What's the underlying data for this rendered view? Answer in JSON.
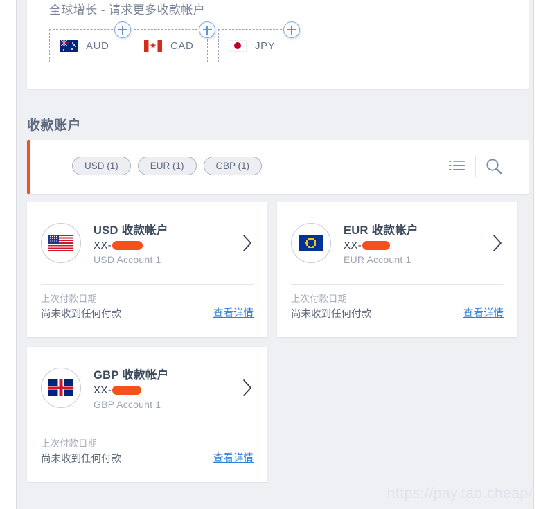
{
  "global_growth": {
    "title": "全球增长 - 请求更多收款帐户",
    "currencies": [
      {
        "code": "AUD",
        "flag": "australia-flag-icon",
        "add_icon": "plus-circle-icon"
      },
      {
        "code": "CAD",
        "flag": "canada-flag-icon",
        "add_icon": "plus-circle-icon"
      },
      {
        "code": "JPY",
        "flag": "japan-flag-icon",
        "add_icon": "plus-circle-icon"
      }
    ]
  },
  "section": {
    "heading": "收款账户"
  },
  "filter_bar": {
    "accent_color": "#f4511e",
    "pills": [
      {
        "label": "USD (1)"
      },
      {
        "label": "EUR (1)"
      },
      {
        "label": "GBP (1)"
      }
    ],
    "list_view_icon": "list-view-icon",
    "search_icon": "search-icon"
  },
  "accounts": [
    {
      "title": "USD 收款帐户",
      "number_prefix": "XX-",
      "number_redacted": true,
      "redaction_width": 44,
      "subtitle": "USD Account 1",
      "flag": "usa-flag-icon",
      "last_payment_label": "上次付款日期",
      "last_payment_value": "尚未收到任何付款",
      "detail_link": "查看详情",
      "chevron_icon": "chevron-right-icon"
    },
    {
      "title": "EUR 收款帐户",
      "number_prefix": "XX-",
      "number_redacted": true,
      "redaction_width": 40,
      "subtitle": "EUR Account 1",
      "flag": "eu-flag-icon",
      "last_payment_label": "上次付款日期",
      "last_payment_value": "尚未收到任何付款",
      "detail_link": "查看详情",
      "chevron_icon": "chevron-right-icon"
    },
    {
      "title": "GBP 收款帐户",
      "number_prefix": "XX-",
      "number_redacted": true,
      "redaction_width": 42,
      "subtitle": "GBP Account 1",
      "flag": "uk-flag-icon",
      "last_payment_label": "上次付款日期",
      "last_payment_value": "尚未收到任何付款",
      "detail_link": "查看详情",
      "chevron_icon": "chevron-right-icon"
    }
  ],
  "watermark": {
    "text": "https://pay.tao.cheap/"
  }
}
